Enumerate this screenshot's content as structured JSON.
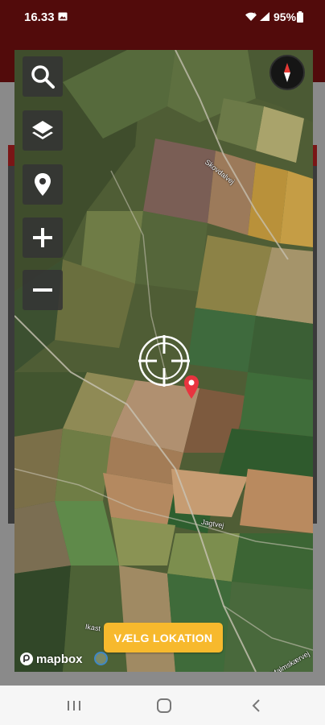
{
  "status_bar": {
    "time": "16.33",
    "battery_percent": "95%",
    "icons": [
      "gallery-icon",
      "wifi-icon",
      "signal-icon",
      "battery-icon"
    ]
  },
  "map": {
    "type": "satellite",
    "controls": [
      "search-icon",
      "layers-icon",
      "location-pin-icon",
      "zoom-in-icon",
      "zoom-out-icon"
    ],
    "compass_icon": "compass-icon",
    "crosshair_icon": "crosshair-icon",
    "marker_icon": "location-marker-icon",
    "marker_color": "#e8343f",
    "labels": {
      "road_1": "Skovdalvej",
      "road_2": "Jagtvej",
      "road_3": "Ikast",
      "road_4": "Malmskærvej"
    }
  },
  "confirm_button": {
    "label": "VÆLG LOKATION",
    "color": "#f7b92d"
  },
  "mapbox": {
    "logo_text": "mapbox"
  },
  "nav_bar": {
    "icons": [
      "recents-icon",
      "home-icon",
      "back-icon"
    ]
  },
  "colors": {
    "status_bar": "#520b0b",
    "map_control_bg": "#343434"
  }
}
